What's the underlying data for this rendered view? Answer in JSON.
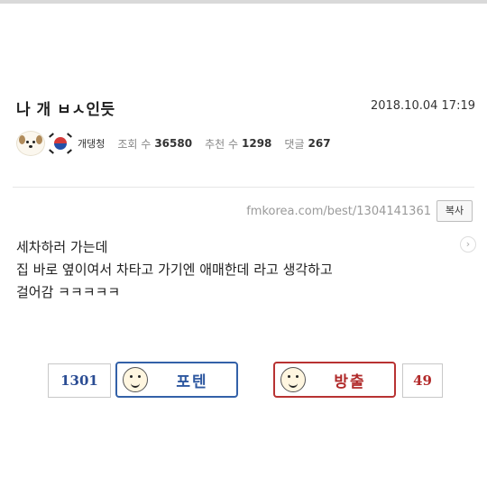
{
  "post": {
    "title": "나 개 ㅂㅅ인듯",
    "date": "2018.10.04 17:19",
    "author": "개댕청",
    "stats": {
      "views_label": "조회 수",
      "views": "36580",
      "recommend_label": "추천 수",
      "recommend": "1298",
      "comments_label": "댓글",
      "comments": "267"
    },
    "url": "fmkorea.com/best/1304141361",
    "copy_label": "복사",
    "body_lines": [
      "세차하러 가는데",
      "집 바로 옆이여서 차타고 가기엔 애매한데 라고 생각하고",
      "걸어감 ㅋㅋㅋㅋㅋ"
    ],
    "next_icon": "›"
  },
  "votes": {
    "up_count": "1301",
    "up_label": "포텐",
    "down_label": "방출",
    "down_count": "49"
  },
  "colors": {
    "up": "#3361a8",
    "down": "#b83232"
  }
}
